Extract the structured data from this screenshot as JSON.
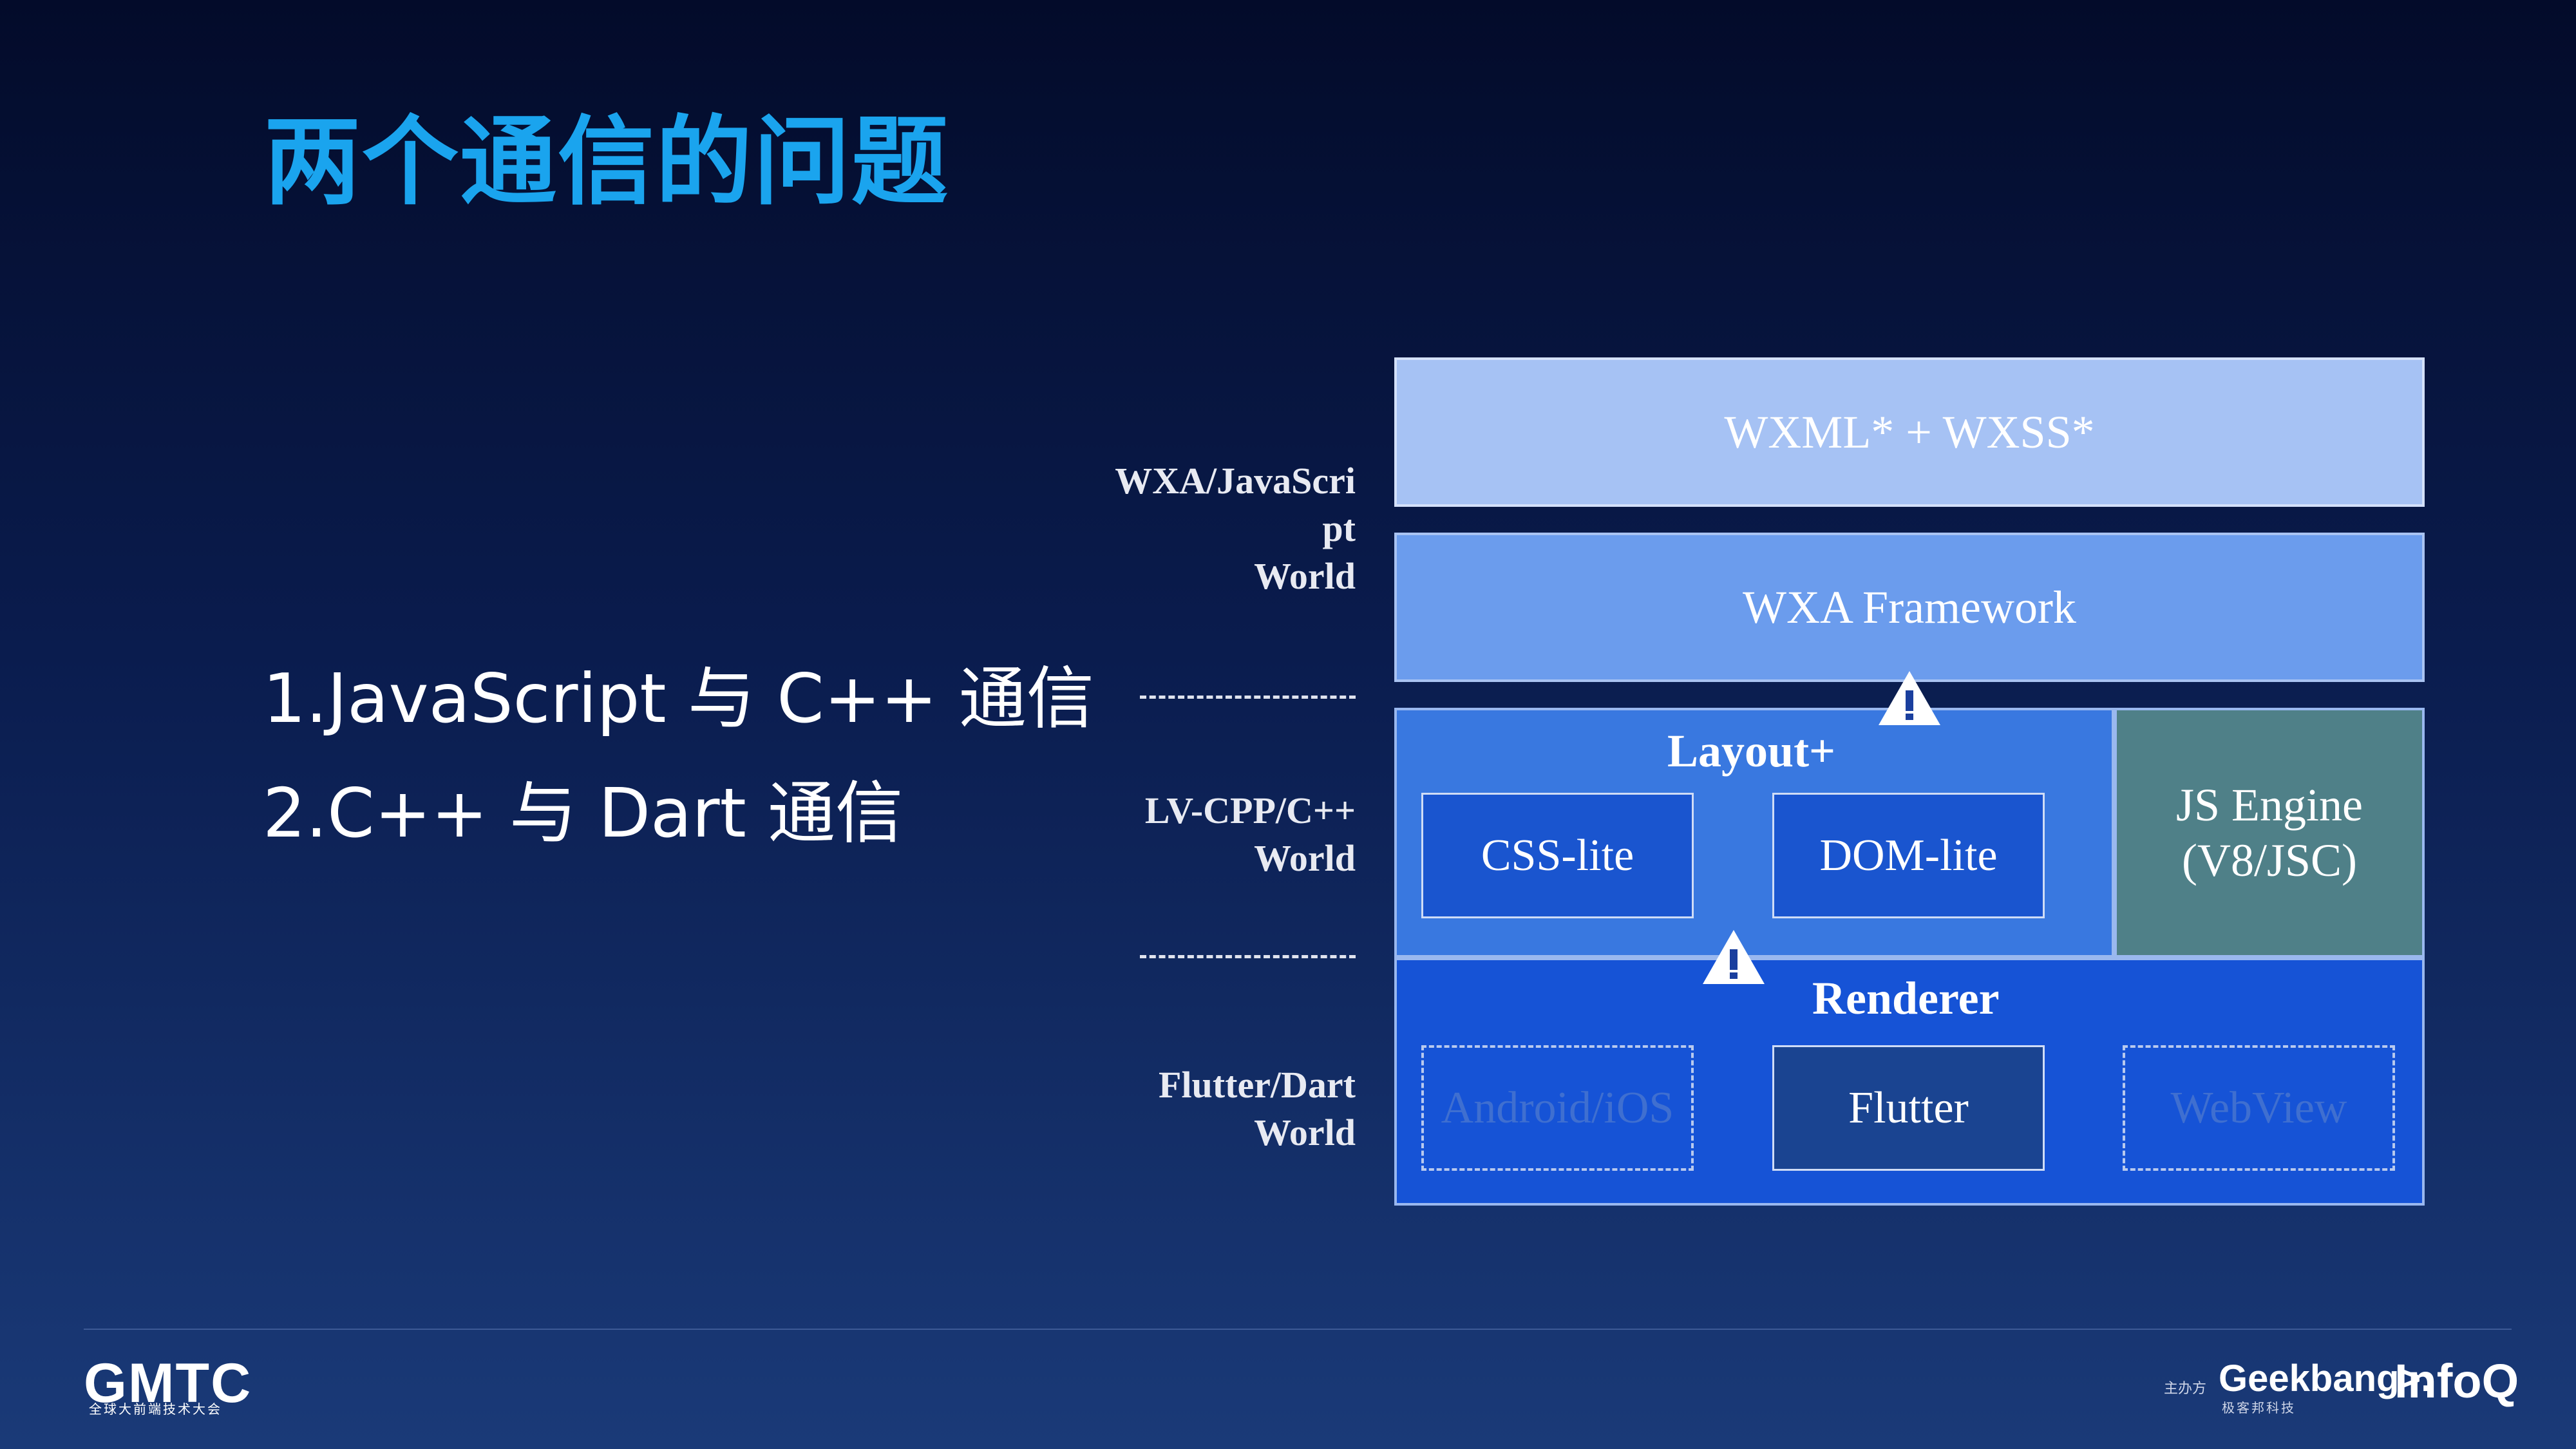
{
  "slide": {
    "title": "两个通信的问题",
    "bullets": [
      "1.JavaScript 与 C++ 通信",
      "2.C++ 与 Dart 通信"
    ]
  },
  "diagram": {
    "worlds": [
      "WXA/JavaScri\npt\nWorld",
      "LV-CPP/C++\nWorld",
      "Flutter/Dart\nWorld"
    ],
    "boxes": {
      "wxml": "WXML* + WXSS*",
      "framework": "WXA Framework",
      "layout": "Layout+",
      "css_lite": "CSS-lite",
      "dom_lite": "DOM-lite",
      "js_engine_line1": "JS Engine",
      "js_engine_line2": "(V8/JSC)",
      "renderer": "Renderer",
      "android_ios": "Android/iOS",
      "flutter": "Flutter",
      "webview": "WebView"
    },
    "colors": {
      "wxml": "#a6c2f4",
      "framework": "#6b9ced",
      "layout": "#3978e0",
      "js_engine": "#4f8088",
      "renderer": "#1653d6",
      "title": "#1aa4ee"
    }
  },
  "footer": {
    "logo_left": "GMTC",
    "logo_left_sub": "全球大前端技术大会",
    "sponsor_label": "主办方",
    "logo_geekbang": "Geekbang>.",
    "logo_geekbang_sub": "极客邦科技",
    "logo_infoq": "InfoQ"
  }
}
